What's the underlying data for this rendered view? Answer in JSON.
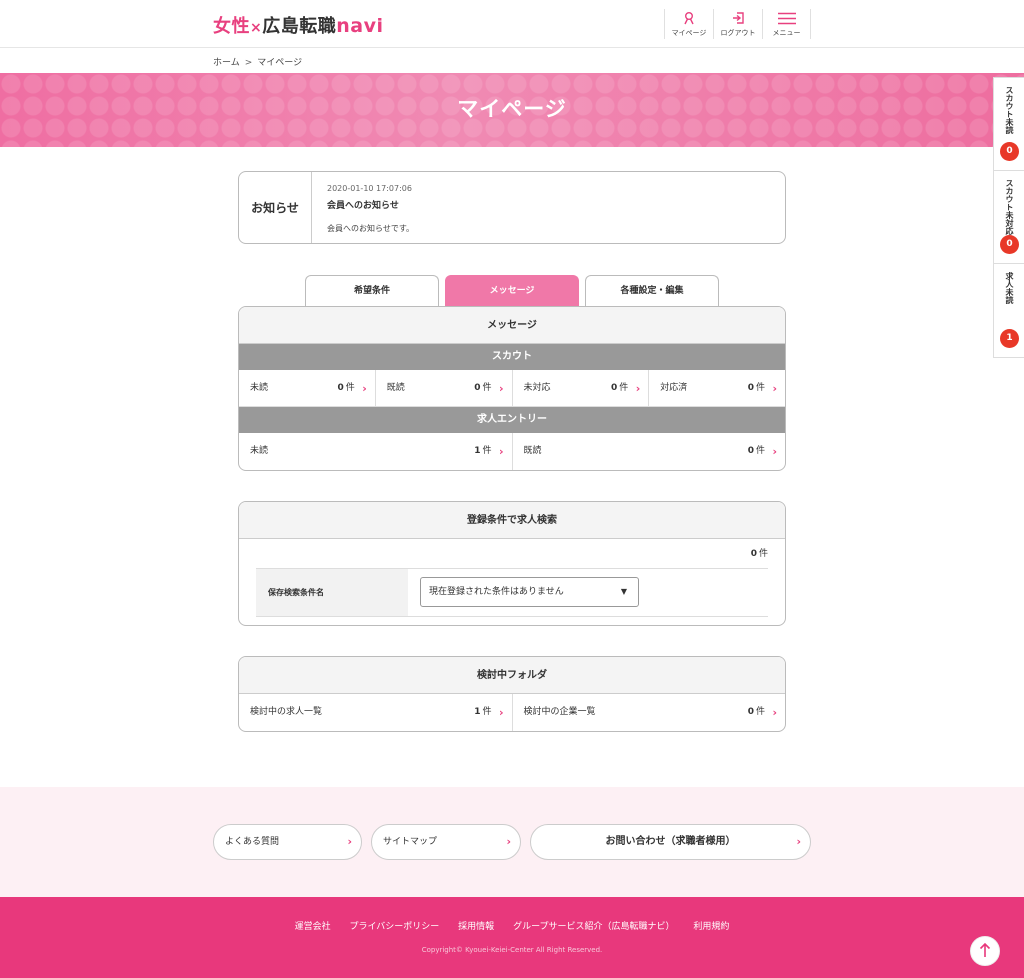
{
  "header": {
    "logo": {
      "part1": "女性",
      "x": "×",
      "part2": "広島転職",
      "part3": "navi"
    },
    "nav": [
      {
        "label": "マイページ",
        "icon": "person-icon"
      },
      {
        "label": "ログアウト",
        "icon": "logout-icon"
      },
      {
        "label": "メニュー",
        "icon": "hamburger-menu-icon"
      }
    ]
  },
  "breadcrumb": {
    "home": "ホーム",
    "sep": ">",
    "current": "マイページ"
  },
  "hero": {
    "title": "マイページ"
  },
  "side_tabs": [
    {
      "label": "スカウト未読",
      "count": "0"
    },
    {
      "label": "スカウト未対応",
      "count": "0"
    },
    {
      "label": "求人未読",
      "count": "1"
    }
  ],
  "notice": {
    "label": "お知らせ",
    "date": "2020-01-10 17:07:06",
    "title": "会員へのお知らせ",
    "text": "会員へのお知らせです。"
  },
  "tabs": [
    {
      "label": "希望条件"
    },
    {
      "label": "メッセージ"
    },
    {
      "label": "各種設定・編集"
    }
  ],
  "messages": {
    "title": "メッセージ",
    "scout": {
      "title": "スカウト",
      "items": [
        {
          "label": "未読",
          "count": "0",
          "unit": "件"
        },
        {
          "label": "既読",
          "count": "0",
          "unit": "件"
        },
        {
          "label": "未対応",
          "count": "0",
          "unit": "件"
        },
        {
          "label": "対応済",
          "count": "0",
          "unit": "件"
        }
      ]
    },
    "entry": {
      "title": "求人エントリー",
      "items": [
        {
          "label": "未読",
          "count": "1",
          "unit": "件"
        },
        {
          "label": "既読",
          "count": "0",
          "unit": "件"
        }
      ]
    }
  },
  "search": {
    "title": "登録条件で求人検索",
    "count": "0",
    "unit": "件",
    "saved_label": "保存検索条件名",
    "select_value": "現在登録された条件はありません"
  },
  "folder": {
    "title": "検討中フォルダ",
    "items": [
      {
        "label": "検討中の求人一覧",
        "count": "1",
        "unit": "件"
      },
      {
        "label": "検討中の企業一覧",
        "count": "0",
        "unit": "件"
      }
    ]
  },
  "footer_links": {
    "faq": "よくある質問",
    "sitemap": "サイトマップ",
    "contact": "お問い合わせ（求職者様用）"
  },
  "footer": {
    "nav": [
      "運営会社",
      "プライバシーポリシー",
      "採用情報",
      "グループサービス紹介（広島転職ナビ）",
      "利用規約"
    ],
    "copyright": "Copyright© Kyouei-Keiei-Center All Right Reserved."
  },
  "colors": {
    "accent": "#e8407f",
    "footer_bg": "#e8387c",
    "badge": "#e83828"
  }
}
